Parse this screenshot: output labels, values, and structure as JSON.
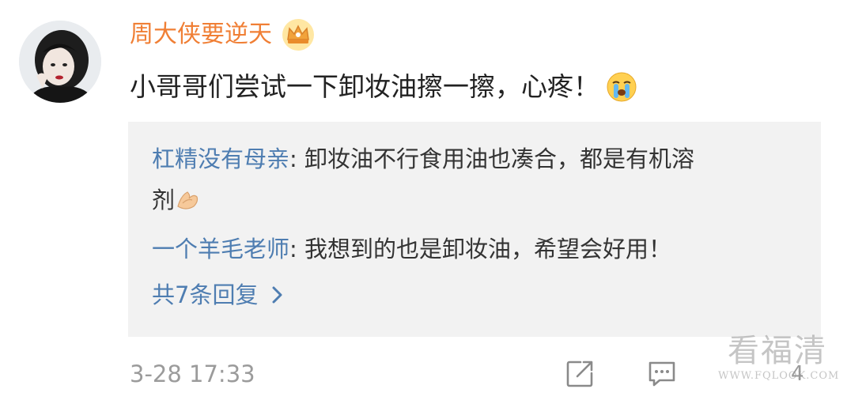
{
  "comment": {
    "username": "周大侠要逆天",
    "text": "小哥哥们尝试一下卸妆油擦一擦，心疼！",
    "timestamp": "3-28 17:33",
    "like_count": "4"
  },
  "replies": [
    {
      "user": "杠精没有母亲",
      "separator": ": ",
      "text_line1": "卸妆油不行食用油也凑合，都是有机溶",
      "text_line2": "剂"
    },
    {
      "user": "一个羊毛老师",
      "separator": ": ",
      "text": "我想到的也是卸妆油，希望会好用！"
    }
  ],
  "more_replies": "共7条回复",
  "watermark": {
    "main": "看福清",
    "sub": "WWW.FQLOOK.COM"
  },
  "icons": {
    "badge": "crown-badge-icon",
    "emoji_comment": "crying-face-icon",
    "emoji_reply": "clapping-hands-icon",
    "share": "share-icon",
    "comment": "comment-icon",
    "chevron": "chevron-right-icon"
  },
  "colors": {
    "username": "#f07f35",
    "reply_username": "#4e7db1",
    "reply_bg": "#f2f2f2",
    "meta": "#9b9b9b"
  }
}
